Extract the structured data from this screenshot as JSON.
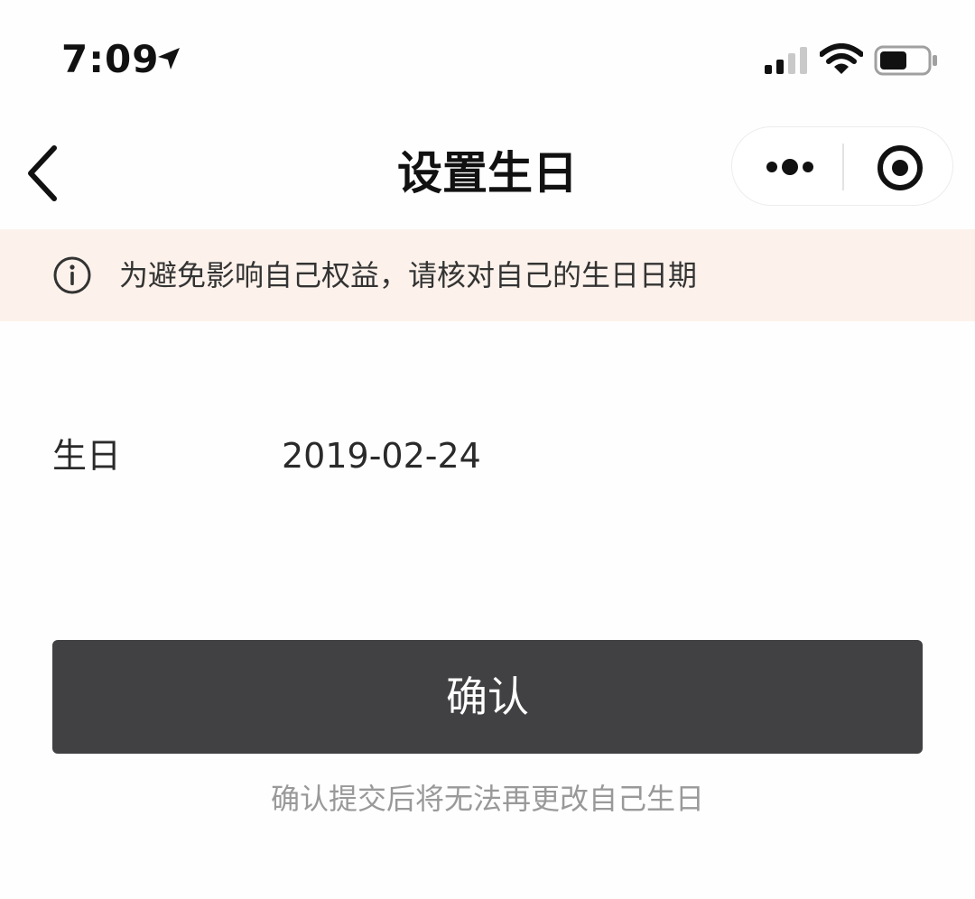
{
  "status_bar": {
    "time": "7:09",
    "icons": [
      "location-arrow-icon",
      "cellular-signal-icon",
      "wifi-icon",
      "battery-icon"
    ]
  },
  "nav": {
    "title": "设置生日",
    "icons": [
      "back-chevron-icon",
      "more-dots-icon",
      "close-target-icon"
    ]
  },
  "notice": {
    "icon": "info-icon",
    "text": "为避免影响自己权益，请核对自己的生日日期",
    "background": "#fdf2eb"
  },
  "form": {
    "birthday_label": "生日",
    "birthday_value": "2019-02-24"
  },
  "confirm": {
    "label": "确认",
    "background": "#414042"
  },
  "hint": "确认提交后将无法再更改自己生日"
}
